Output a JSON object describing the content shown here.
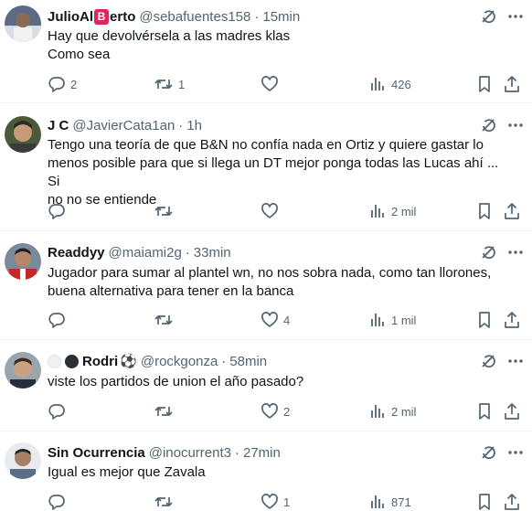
{
  "tweets": [
    {
      "name_part1": "JulioAl",
      "name_badge": "B",
      "name_part2": "erto",
      "handle": "@sebafuentes158",
      "time": "15min",
      "lines": [
        "Hay que devolvérsela a las madres klas",
        "Como sea"
      ],
      "replies": "2",
      "retweets": "1",
      "likes": "",
      "views": "426"
    },
    {
      "name": "J C",
      "handle": "@JavierCata1an",
      "time": "1h",
      "lines": [
        "Tengo una teoría de que B&N no confía nada en Ortiz y quiere gastar lo",
        "menos posible para que si llega un DT mejor ponga todas las Lucas ahí ... Si",
        "no no se entiende"
      ],
      "replies": "",
      "retweets": "",
      "likes": "",
      "views": "2 mil"
    },
    {
      "name": "Readdyy",
      "handle": "@maiami2g",
      "time": "33min",
      "lines": [
        "Jugador para sumar al plantel wn, no nos sobra nada, como tan llorones,",
        "buena alternativa para tener en la banca"
      ],
      "replies": "",
      "retweets": "",
      "likes": "4",
      "views": "1 mil"
    },
    {
      "name": "Rodri",
      "name_emoji": "⚽",
      "handle": "@rockgonza",
      "time": "58min",
      "lines": [
        "viste los partidos de union el año pasado?"
      ],
      "replies": "",
      "retweets": "",
      "likes": "2",
      "views": "2 mil"
    },
    {
      "name": "Sin Ocurrencia",
      "handle": "@inocurrent3",
      "time": "27min",
      "lines": [
        "Igual es mejor que Zavala"
      ],
      "replies": "",
      "retweets": "",
      "likes": "1",
      "views": "871"
    }
  ],
  "separator": "·",
  "icons": {
    "grok": "grok-icon",
    "more": "more-options-icon",
    "reply": "reply-icon",
    "retweet": "retweet-icon",
    "like": "like-icon",
    "views": "views-icon",
    "bookmark": "bookmark-icon",
    "share": "share-icon"
  },
  "colors": {
    "text": "#0f1419",
    "secondary": "#536471",
    "divider": "#eff3f4",
    "badge_red": "#e0245e"
  }
}
